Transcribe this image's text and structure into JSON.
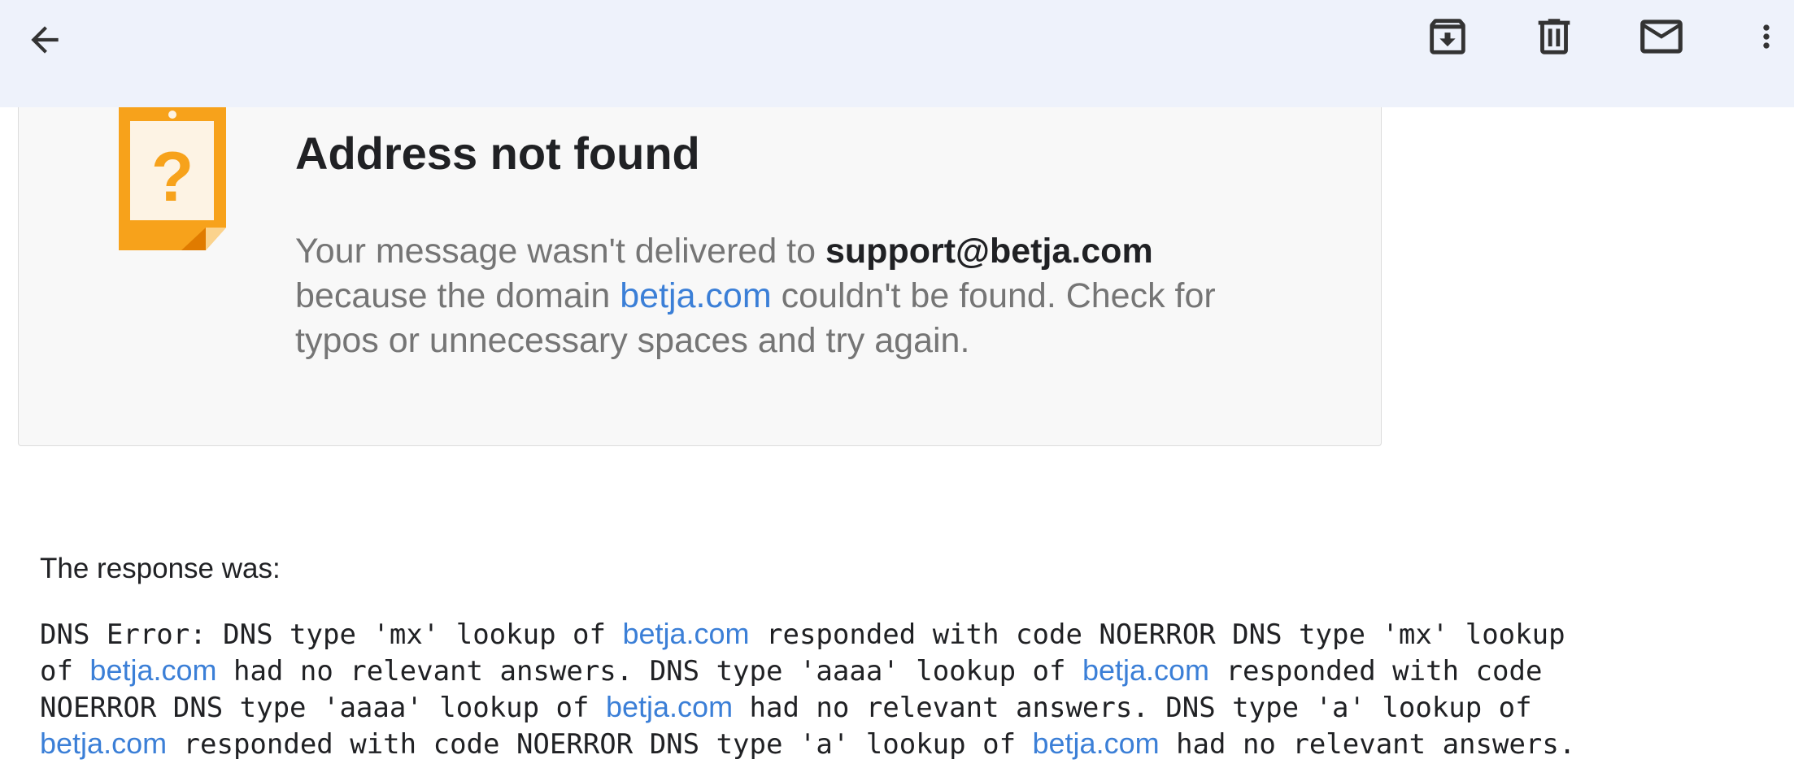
{
  "toolbar": {
    "back_icon": "arrow-back-icon",
    "archive_icon": "archive-icon",
    "delete_icon": "delete-icon",
    "mail_icon": "mail-icon",
    "more_icon": "more-vert-icon"
  },
  "card": {
    "icon": "warning-note-icon",
    "icon_glyph": "?",
    "icon_color": "#f5a623",
    "title": "Address not found",
    "msg_part1": "Your message wasn't delivered to ",
    "recipient": "support@betja.com",
    "msg_part2": "because the domain ",
    "domain_link": "betja.com",
    "msg_part3": " couldn't be found. Check for",
    "msg_part4": "typos or unnecessary spaces and try again."
  },
  "response": {
    "label": "The response was:",
    "lines": [
      {
        "parts": [
          "DNS Error: DNS type 'mx' lookup of ",
          {
            "link": "betja.com"
          },
          " responded with code NOERROR DNS type 'mx' lookup"
        ]
      },
      {
        "parts": [
          "of ",
          {
            "link": "betja.com"
          },
          " had no relevant answers. DNS type 'aaaa' lookup of ",
          {
            "link": "betja.com"
          },
          " responded with code"
        ]
      },
      {
        "parts": [
          "NOERROR DNS type 'aaaa' lookup of ",
          {
            "link": "betja.com"
          },
          " had no relevant answers. DNS type 'a' lookup of"
        ]
      },
      {
        "parts": [
          {
            "link": "betja.com"
          },
          " responded with code NOERROR DNS type 'a' lookup of ",
          {
            "link": "betja.com"
          },
          " had no relevant answers."
        ]
      }
    ]
  },
  "colors": {
    "toolbar_bg": "#eef2fb",
    "link": "#3b7fd7",
    "icon": "#333333"
  }
}
